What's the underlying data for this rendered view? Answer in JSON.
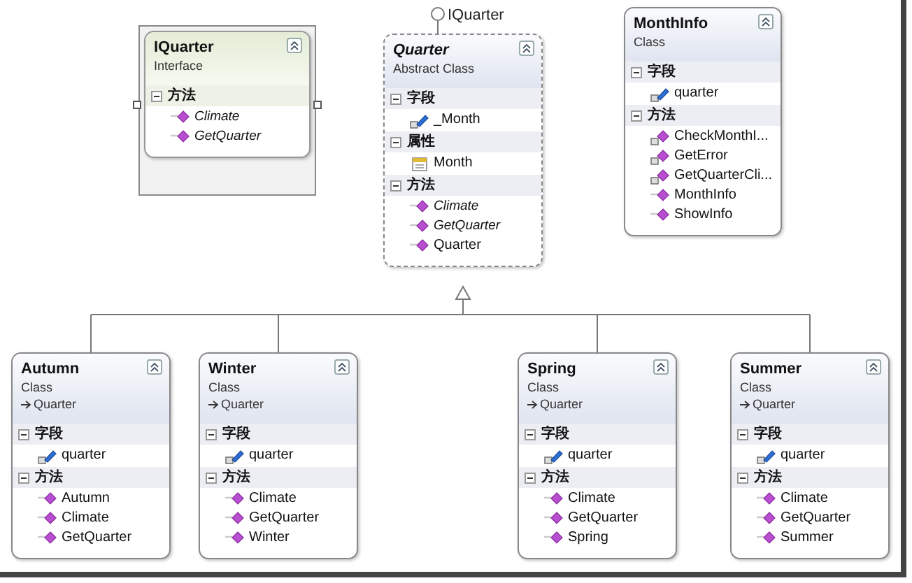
{
  "classes": [
    {
      "name": "IQuarter",
      "stereotype": "Interface",
      "kind": "interface",
      "selected": true,
      "sections": [
        {
          "title": "方法",
          "members": [
            {
              "name": "Climate",
              "kind": "method",
              "private": false,
              "abstract": true
            },
            {
              "name": "GetQuarter",
              "kind": "method",
              "private": false,
              "abstract": true
            }
          ]
        }
      ]
    },
    {
      "name": "Quarter",
      "stereotype": "Abstract Class",
      "kind": "abstract",
      "selected": false,
      "implements": "IQuarter",
      "sections": [
        {
          "title": "字段",
          "members": [
            {
              "name": "_Month",
              "kind": "field",
              "private": true,
              "abstract": false
            }
          ]
        },
        {
          "title": "属性",
          "members": [
            {
              "name": "Month",
              "kind": "property",
              "private": false,
              "abstract": false
            }
          ]
        },
        {
          "title": "方法",
          "members": [
            {
              "name": "Climate",
              "kind": "method",
              "private": false,
              "abstract": true
            },
            {
              "name": "GetQuarter",
              "kind": "method",
              "private": false,
              "abstract": true
            },
            {
              "name": "Quarter",
              "kind": "method",
              "private": false,
              "abstract": false
            }
          ]
        }
      ]
    },
    {
      "name": "MonthInfo",
      "stereotype": "Class",
      "kind": "class",
      "selected": false,
      "sections": [
        {
          "title": "字段",
          "members": [
            {
              "name": "quarter",
              "kind": "field",
              "private": true,
              "abstract": false
            }
          ]
        },
        {
          "title": "方法",
          "members": [
            {
              "name": "CheckMonthI...",
              "kind": "method",
              "private": true,
              "abstract": false
            },
            {
              "name": "GetError",
              "kind": "method",
              "private": true,
              "abstract": false
            },
            {
              "name": "GetQuarterCli...",
              "kind": "method",
              "private": true,
              "abstract": false
            },
            {
              "name": "MonthInfo",
              "kind": "method",
              "private": false,
              "abstract": false
            },
            {
              "name": "ShowInfo",
              "kind": "method",
              "private": false,
              "abstract": false
            }
          ]
        }
      ]
    },
    {
      "name": "Autumn",
      "stereotype": "Class",
      "kind": "class",
      "selected": false,
      "base": "Quarter",
      "sections": [
        {
          "title": "字段",
          "members": [
            {
              "name": "quarter",
              "kind": "field",
              "private": true,
              "abstract": false
            }
          ]
        },
        {
          "title": "方法",
          "members": [
            {
              "name": "Autumn",
              "kind": "method",
              "private": false,
              "abstract": false
            },
            {
              "name": "Climate",
              "kind": "method",
              "private": false,
              "abstract": false
            },
            {
              "name": "GetQuarter",
              "kind": "method",
              "private": false,
              "abstract": false
            }
          ]
        }
      ]
    },
    {
      "name": "Winter",
      "stereotype": "Class",
      "kind": "class",
      "selected": false,
      "base": "Quarter",
      "sections": [
        {
          "title": "字段",
          "members": [
            {
              "name": "quarter",
              "kind": "field",
              "private": true,
              "abstract": false
            }
          ]
        },
        {
          "title": "方法",
          "members": [
            {
              "name": "Climate",
              "kind": "method",
              "private": false,
              "abstract": false
            },
            {
              "name": "GetQuarter",
              "kind": "method",
              "private": false,
              "abstract": false
            },
            {
              "name": "Winter",
              "kind": "method",
              "private": false,
              "abstract": false
            }
          ]
        }
      ]
    },
    {
      "name": "Spring",
      "stereotype": "Class",
      "kind": "class",
      "selected": false,
      "base": "Quarter",
      "sections": [
        {
          "title": "字段",
          "members": [
            {
              "name": "quarter",
              "kind": "field",
              "private": true,
              "abstract": false
            }
          ]
        },
        {
          "title": "方法",
          "members": [
            {
              "name": "Climate",
              "kind": "method",
              "private": false,
              "abstract": false
            },
            {
              "name": "GetQuarter",
              "kind": "method",
              "private": false,
              "abstract": false
            },
            {
              "name": "Spring",
              "kind": "method",
              "private": false,
              "abstract": false
            }
          ]
        }
      ]
    },
    {
      "name": "Summer",
      "stereotype": "Class",
      "kind": "class",
      "selected": false,
      "base": "Quarter",
      "sections": [
        {
          "title": "字段",
          "members": [
            {
              "name": "quarter",
              "kind": "field",
              "private": true,
              "abstract": false
            }
          ]
        },
        {
          "title": "方法",
          "members": [
            {
              "name": "Climate",
              "kind": "method",
              "private": false,
              "abstract": false
            },
            {
              "name": "GetQuarter",
              "kind": "method",
              "private": false,
              "abstract": false
            },
            {
              "name": "Summer",
              "kind": "method",
              "private": false,
              "abstract": false
            }
          ]
        }
      ]
    }
  ]
}
